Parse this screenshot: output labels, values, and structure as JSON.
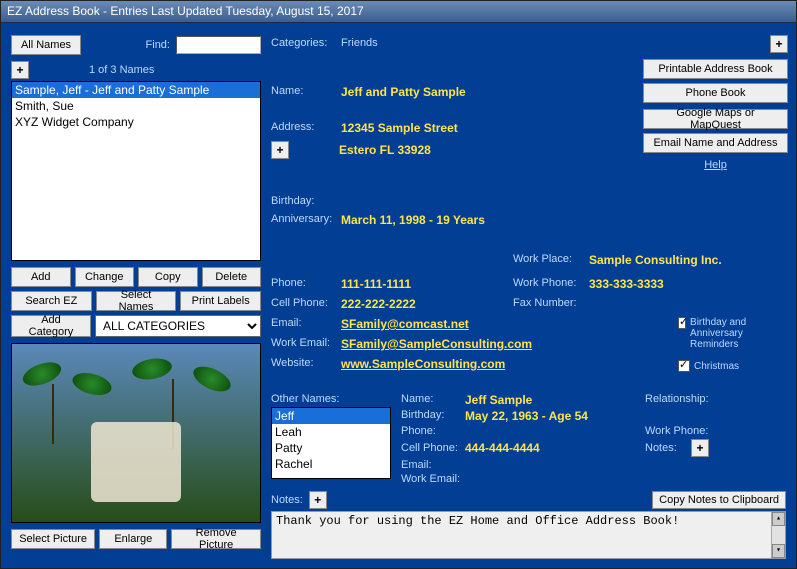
{
  "title": "EZ Address Book - Entries Last Updated Tuesday, August 15, 2017",
  "left": {
    "all_names_btn": "All Names",
    "find_label": "Find:",
    "find_value": "",
    "count_label": "1 of 3 Names",
    "names": [
      "Sample, Jeff - Jeff and Patty Sample",
      "Smith, Sue",
      "XYZ Widget Company"
    ],
    "selected_index": 0,
    "buttons": {
      "add": "Add",
      "change": "Change",
      "copy": "Copy",
      "delete": "Delete",
      "search": "Search EZ",
      "select_names": "Select Names",
      "print_labels": "Print Labels",
      "add_category": "Add Category"
    },
    "category_dropdown": "ALL CATEGORIES",
    "picture_buttons": {
      "select": "Select Picture",
      "enlarge": "Enlarge",
      "remove": "Remove Picture"
    }
  },
  "right_buttons": {
    "printable": "Printable Address Book",
    "phone": "Phone Book",
    "maps": "Google Maps or MapQuest",
    "email": "Email Name and Address",
    "help": "Help"
  },
  "detail": {
    "categories_label": "Categories:",
    "categories_value": "Friends",
    "name_label": "Name:",
    "name_value": "Jeff and Patty Sample",
    "address_label": "Address:",
    "address_line1": "12345 Sample Street",
    "address_line2": "Estero FL  33928",
    "birthday_label": "Birthday:",
    "anniversary_label": "Anniversary:",
    "anniversary_value": "March 11, 1998   -   19 Years",
    "phone_label": "Phone:",
    "phone_value": "111-111-1111",
    "cell_label": "Cell Phone:",
    "cell_value": "222-222-2222",
    "email_label": "Email:",
    "email_value": "SFamily@comcast.net",
    "workemail_label": "Work Email:",
    "workemail_value": "SFamily@SampleConsulting.com",
    "website_label": "Website:",
    "website_value": "www.SampleConsulting.com",
    "workplace_label": "Work Place:",
    "workplace_value": "Sample Consulting Inc.",
    "workphone_label": "Work Phone:",
    "workphone_value": "333-333-3333",
    "fax_label": "Fax Number:",
    "reminders": {
      "birthday_anniversary": "Birthday and Anniversary Reminders",
      "christmas": "Christmas"
    }
  },
  "other": {
    "other_names_label": "Other Names:",
    "names": [
      "Jeff",
      "Leah",
      "Patty",
      "Rachel"
    ],
    "selected_index": 0,
    "d_name_label": "Name:",
    "d_name_value": "Jeff Sample",
    "d_birthday_label": "Birthday:",
    "d_birthday_value": "May 22, 1963 - Age 54",
    "d_phone_label": "Phone:",
    "d_cell_label": "Cell Phone:",
    "d_cell_value": "444-444-4444",
    "d_email_label": "Email:",
    "d_workemail_label": "Work Email:",
    "d_relationship_label": "Relationship:",
    "d_workphone_label": "Work Phone:",
    "d_notes_label": "Notes:"
  },
  "notes": {
    "label": "Notes:",
    "copy_btn": "Copy Notes to Clipboard",
    "text": "Thank you for using the EZ Home and Office Address Book!"
  }
}
